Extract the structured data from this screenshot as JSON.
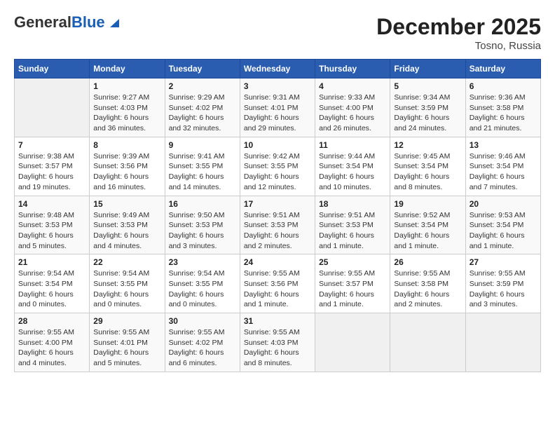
{
  "logo": {
    "general": "General",
    "blue": "Blue"
  },
  "header": {
    "month": "December 2025",
    "location": "Tosno, Russia"
  },
  "weekdays": [
    "Sunday",
    "Monday",
    "Tuesday",
    "Wednesday",
    "Thursday",
    "Friday",
    "Saturday"
  ],
  "weeks": [
    [
      {
        "day": null
      },
      {
        "day": "1",
        "sunrise": "Sunrise: 9:27 AM",
        "sunset": "Sunset: 4:03 PM",
        "daylight": "Daylight: 6 hours and 36 minutes."
      },
      {
        "day": "2",
        "sunrise": "Sunrise: 9:29 AM",
        "sunset": "Sunset: 4:02 PM",
        "daylight": "Daylight: 6 hours and 32 minutes."
      },
      {
        "day": "3",
        "sunrise": "Sunrise: 9:31 AM",
        "sunset": "Sunset: 4:01 PM",
        "daylight": "Daylight: 6 hours and 29 minutes."
      },
      {
        "day": "4",
        "sunrise": "Sunrise: 9:33 AM",
        "sunset": "Sunset: 4:00 PM",
        "daylight": "Daylight: 6 hours and 26 minutes."
      },
      {
        "day": "5",
        "sunrise": "Sunrise: 9:34 AM",
        "sunset": "Sunset: 3:59 PM",
        "daylight": "Daylight: 6 hours and 24 minutes."
      },
      {
        "day": "6",
        "sunrise": "Sunrise: 9:36 AM",
        "sunset": "Sunset: 3:58 PM",
        "daylight": "Daylight: 6 hours and 21 minutes."
      }
    ],
    [
      {
        "day": "7",
        "sunrise": "Sunrise: 9:38 AM",
        "sunset": "Sunset: 3:57 PM",
        "daylight": "Daylight: 6 hours and 19 minutes."
      },
      {
        "day": "8",
        "sunrise": "Sunrise: 9:39 AM",
        "sunset": "Sunset: 3:56 PM",
        "daylight": "Daylight: 6 hours and 16 minutes."
      },
      {
        "day": "9",
        "sunrise": "Sunrise: 9:41 AM",
        "sunset": "Sunset: 3:55 PM",
        "daylight": "Daylight: 6 hours and 14 minutes."
      },
      {
        "day": "10",
        "sunrise": "Sunrise: 9:42 AM",
        "sunset": "Sunset: 3:55 PM",
        "daylight": "Daylight: 6 hours and 12 minutes."
      },
      {
        "day": "11",
        "sunrise": "Sunrise: 9:44 AM",
        "sunset": "Sunset: 3:54 PM",
        "daylight": "Daylight: 6 hours and 10 minutes."
      },
      {
        "day": "12",
        "sunrise": "Sunrise: 9:45 AM",
        "sunset": "Sunset: 3:54 PM",
        "daylight": "Daylight: 6 hours and 8 minutes."
      },
      {
        "day": "13",
        "sunrise": "Sunrise: 9:46 AM",
        "sunset": "Sunset: 3:54 PM",
        "daylight": "Daylight: 6 hours and 7 minutes."
      }
    ],
    [
      {
        "day": "14",
        "sunrise": "Sunrise: 9:48 AM",
        "sunset": "Sunset: 3:53 PM",
        "daylight": "Daylight: 6 hours and 5 minutes."
      },
      {
        "day": "15",
        "sunrise": "Sunrise: 9:49 AM",
        "sunset": "Sunset: 3:53 PM",
        "daylight": "Daylight: 6 hours and 4 minutes."
      },
      {
        "day": "16",
        "sunrise": "Sunrise: 9:50 AM",
        "sunset": "Sunset: 3:53 PM",
        "daylight": "Daylight: 6 hours and 3 minutes."
      },
      {
        "day": "17",
        "sunrise": "Sunrise: 9:51 AM",
        "sunset": "Sunset: 3:53 PM",
        "daylight": "Daylight: 6 hours and 2 minutes."
      },
      {
        "day": "18",
        "sunrise": "Sunrise: 9:51 AM",
        "sunset": "Sunset: 3:53 PM",
        "daylight": "Daylight: 6 hours and 1 minute."
      },
      {
        "day": "19",
        "sunrise": "Sunrise: 9:52 AM",
        "sunset": "Sunset: 3:54 PM",
        "daylight": "Daylight: 6 hours and 1 minute."
      },
      {
        "day": "20",
        "sunrise": "Sunrise: 9:53 AM",
        "sunset": "Sunset: 3:54 PM",
        "daylight": "Daylight: 6 hours and 1 minute."
      }
    ],
    [
      {
        "day": "21",
        "sunrise": "Sunrise: 9:54 AM",
        "sunset": "Sunset: 3:54 PM",
        "daylight": "Daylight: 6 hours and 0 minutes."
      },
      {
        "day": "22",
        "sunrise": "Sunrise: 9:54 AM",
        "sunset": "Sunset: 3:55 PM",
        "daylight": "Daylight: 6 hours and 0 minutes."
      },
      {
        "day": "23",
        "sunrise": "Sunrise: 9:54 AM",
        "sunset": "Sunset: 3:55 PM",
        "daylight": "Daylight: 6 hours and 0 minutes."
      },
      {
        "day": "24",
        "sunrise": "Sunrise: 9:55 AM",
        "sunset": "Sunset: 3:56 PM",
        "daylight": "Daylight: 6 hours and 1 minute."
      },
      {
        "day": "25",
        "sunrise": "Sunrise: 9:55 AM",
        "sunset": "Sunset: 3:57 PM",
        "daylight": "Daylight: 6 hours and 1 minute."
      },
      {
        "day": "26",
        "sunrise": "Sunrise: 9:55 AM",
        "sunset": "Sunset: 3:58 PM",
        "daylight": "Daylight: 6 hours and 2 minutes."
      },
      {
        "day": "27",
        "sunrise": "Sunrise: 9:55 AM",
        "sunset": "Sunset: 3:59 PM",
        "daylight": "Daylight: 6 hours and 3 minutes."
      }
    ],
    [
      {
        "day": "28",
        "sunrise": "Sunrise: 9:55 AM",
        "sunset": "Sunset: 4:00 PM",
        "daylight": "Daylight: 6 hours and 4 minutes."
      },
      {
        "day": "29",
        "sunrise": "Sunrise: 9:55 AM",
        "sunset": "Sunset: 4:01 PM",
        "daylight": "Daylight: 6 hours and 5 minutes."
      },
      {
        "day": "30",
        "sunrise": "Sunrise: 9:55 AM",
        "sunset": "Sunset: 4:02 PM",
        "daylight": "Daylight: 6 hours and 6 minutes."
      },
      {
        "day": "31",
        "sunrise": "Sunrise: 9:55 AM",
        "sunset": "Sunset: 4:03 PM",
        "daylight": "Daylight: 6 hours and 8 minutes."
      },
      {
        "day": null
      },
      {
        "day": null
      },
      {
        "day": null
      }
    ]
  ]
}
